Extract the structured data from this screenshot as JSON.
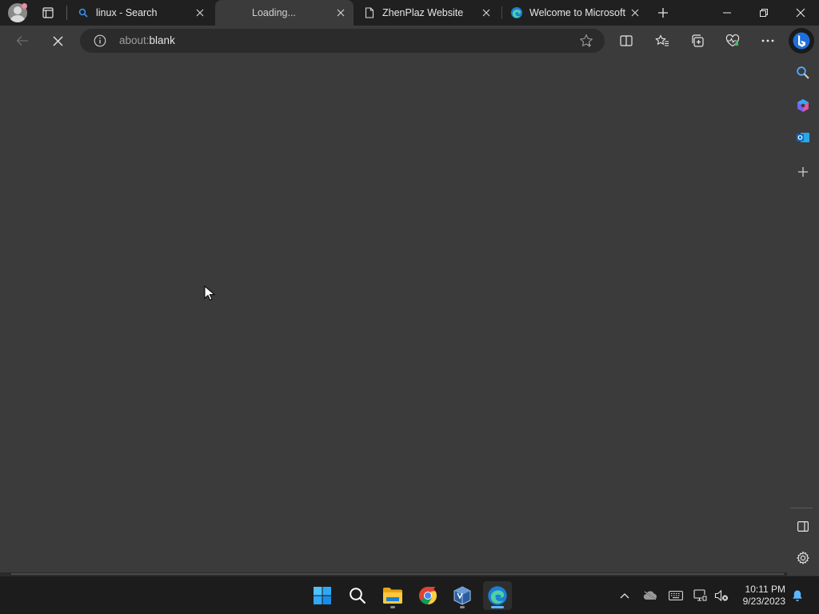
{
  "tabs": [
    {
      "title": "linux - Search",
      "icon": "search-favicon",
      "active": false
    },
    {
      "title": "Loading...",
      "icon": "none",
      "active": true
    },
    {
      "title": "ZhenPlaz Website",
      "icon": "page-favicon",
      "active": false
    },
    {
      "title": "Welcome to Microsoft",
      "icon": "edge-favicon",
      "active": false
    }
  ],
  "address_bar": {
    "url_prefix": "about:",
    "url_rest": "blank"
  },
  "taskbar": {
    "apps": [
      "start",
      "search",
      "file-explorer",
      "chrome",
      "virtualbox",
      "edge"
    ],
    "active_app": "edge"
  },
  "clock": {
    "time": "10:11 PM",
    "date": "9/23/2023"
  },
  "colors": {
    "content_bg": "#3b3b3b",
    "titlebar_bg": "#202020",
    "taskbar_bg": "#1c1c1c",
    "accent": "#5db7ff"
  }
}
